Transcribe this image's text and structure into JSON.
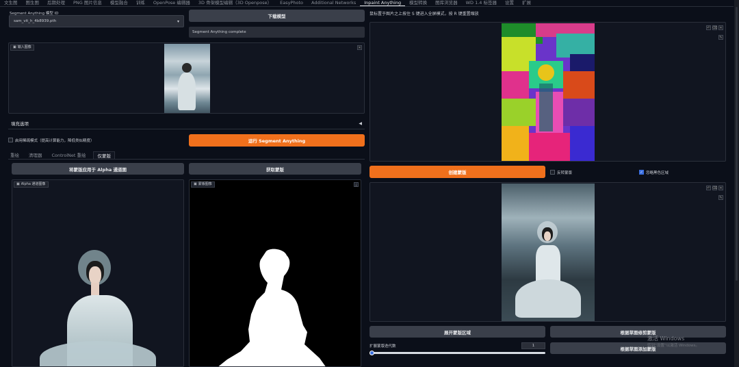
{
  "tabs": [
    "文生图",
    "图生图",
    "后期处理",
    "PNG 图片信息",
    "模型融合",
    "训练",
    "OpenPose 编辑器",
    "3D 骨架模型编辑（3D Openpose）",
    "EasyPhoto",
    "Additional Networks",
    "Inpaint Anything",
    "模型转换",
    "图库浏览器",
    "WD 1.4 标签器",
    "设置",
    "扩展"
  ],
  "active_tab": "Inpaint Anything",
  "left": {
    "model_label": "Segment Anything 模型 ID",
    "model_value": "sam_vit_h_4b8939.pth",
    "download_button": "下载模型",
    "status_text": "Segment Anything complete",
    "input_image_label": "输入图像",
    "fill_options_label": "填充选项",
    "checkbox_label": "启用稀疏模式（提高计算能力，降低类似精度）",
    "run_button": "运行 Segment Anything",
    "subtabs": [
      "重绘",
      "清理器",
      "ControlNet 重绘",
      "仅蒙版"
    ],
    "active_subtab": "仅蒙版",
    "apply_alpha_button": "将蒙版应用于 Alpha 通道图",
    "get_mask_button": "获取蒙版",
    "alpha_image_label": "Alpha 通道图像",
    "mask_image_label": "蒙版图像"
  },
  "right": {
    "hint_text": "鼠标置于图片之上按住 S 键进入全屏模式，按 R 键重置缩放",
    "create_mask_button": "创建蒙版",
    "invert_mask_label": "反转蒙版",
    "ignore_black_label": "忽略黑色区域",
    "ignore_black_checked": true,
    "expand_button": "展开蒙版区域",
    "trim_button": "根据草图修剪蒙版",
    "add_button": "根据草图添加蒙版",
    "iterations_label": "扩展蒙版迭代数",
    "iterations_value": "1",
    "iterations_fraction": 0.0
  },
  "watermark": {
    "line1": "激活 Windows",
    "line2": "转到“设置”以激活 Windows。"
  }
}
